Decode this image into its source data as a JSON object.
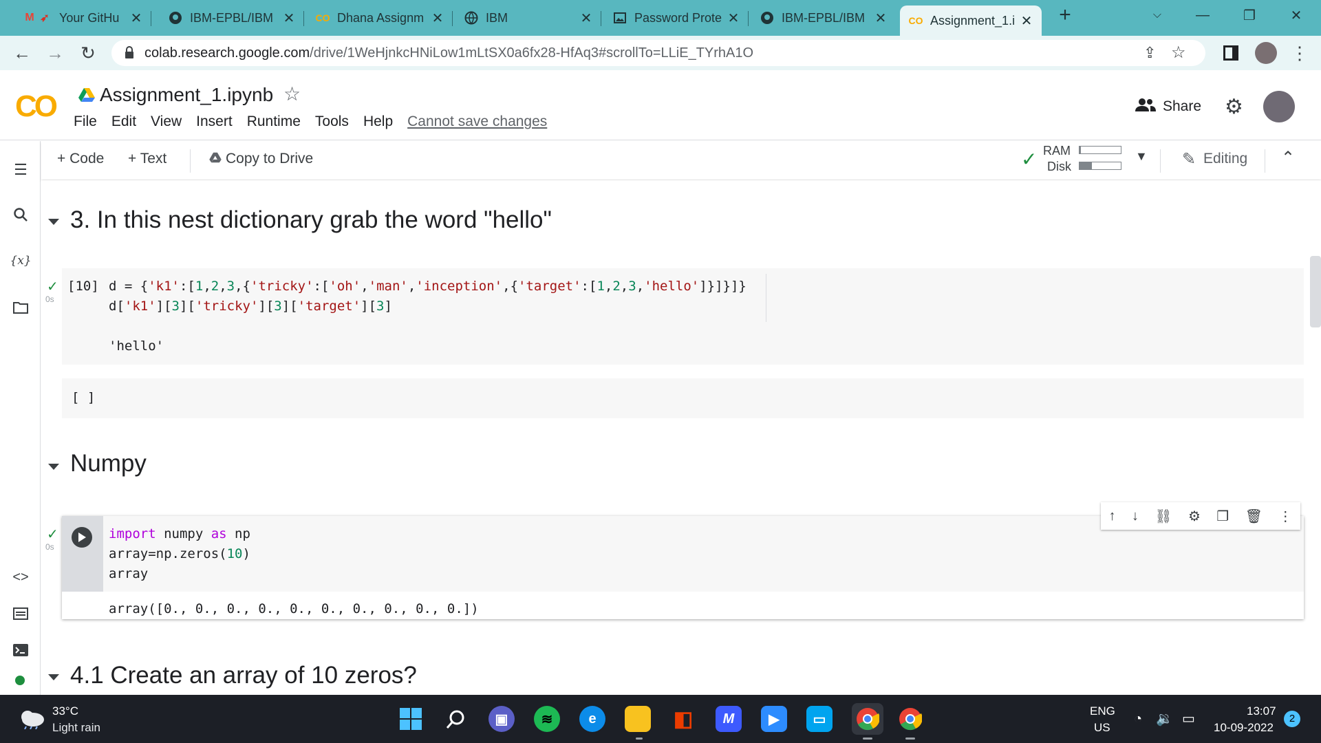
{
  "browser": {
    "tabs": [
      {
        "title": "Your GitHu",
        "icon": "gmail-icon"
      },
      {
        "title": "IBM-EPBL/IBM",
        "icon": "github-icon"
      },
      {
        "title": "Dhana Assignm",
        "icon": "colab-icon"
      },
      {
        "title": "IBM",
        "icon": "globe-icon"
      },
      {
        "title": "Password Prote",
        "icon": "image-icon"
      },
      {
        "title": "IBM-EPBL/IBM",
        "icon": "github-icon"
      },
      {
        "title": "Assignment_1.i",
        "icon": "colab-icon"
      }
    ],
    "url_host": "colab.research.google.com",
    "url_path": "/drive/1WeHjnkcHNiLow1mLtSX0a6fx28-HfAq3#scrollTo=LLiE_TYrhA1O"
  },
  "colab": {
    "notebook_title": "Assignment_1.ipynb",
    "menu": [
      "File",
      "Edit",
      "View",
      "Insert",
      "Runtime",
      "Tools",
      "Help"
    ],
    "cannot_save": "Cannot save changes",
    "share_label": "Share",
    "toolbar": {
      "code": "+ Code",
      "text": "+ Text",
      "copy": "Copy to Drive",
      "ram": "RAM",
      "disk": "Disk",
      "editing": "Editing"
    }
  },
  "sections": {
    "h3": "3. In this nest dictionary grab the word \"hello\"",
    "numpy": "Numpy",
    "h41": "4.1 Create an array of 10 zeros?"
  },
  "cells": {
    "c1_count": "[10]",
    "c1_time": "0s",
    "c1_output": "'hello'",
    "c2_empty": "[ ]",
    "c3_time": "0s",
    "c3_output": "array([0., 0., 0., 0., 0., 0., 0., 0., 0., 0.])"
  },
  "taskbar": {
    "temp": "33°C",
    "weather": "Light rain",
    "lang1": "ENG",
    "lang2": "US",
    "time": "13:07",
    "date": "10-09-2022",
    "badge": "2"
  },
  "colors": {
    "tabbar": "#58b7bf",
    "accent": "#f9ab00",
    "taskbar": "#1c1f26"
  }
}
